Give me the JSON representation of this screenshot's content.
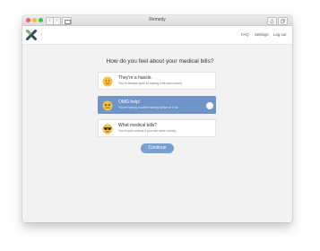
{
  "window": {
    "title": "Remedy"
  },
  "header": {
    "logo_icon": "remedy-x-logo",
    "nav": [
      {
        "label": "FAQ"
      },
      {
        "label": "Settings"
      },
      {
        "label": "Log out"
      }
    ]
  },
  "main": {
    "question": "How do you feel about your medical bills?",
    "options": [
      {
        "title": "They're a hassle.",
        "subtitle": "You're always open to saving time and money.",
        "icon": "neutral-face-icon",
        "selected": false
      },
      {
        "title": "OMG help!",
        "subtitle": "You're having trouble making sense of it all.",
        "icon": "confounded-face-icon",
        "selected": true
      },
      {
        "title": "What medical bills?",
        "subtitle": "You're just curious if you can save money.",
        "icon": "sunglasses-face-icon",
        "selected": false
      }
    ],
    "continue_label": "Continue"
  },
  "colors": {
    "accent": "#6f95c8",
    "button": "#78a1d2",
    "logo": "#2f4a5e"
  }
}
